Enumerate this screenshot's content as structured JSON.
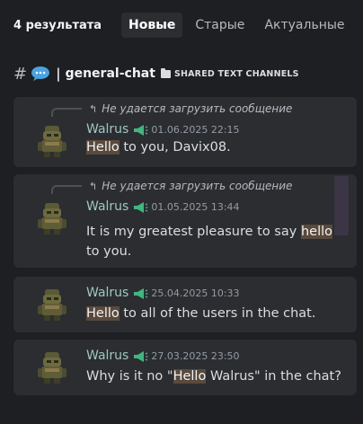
{
  "header": {
    "result_count": "4 результата",
    "tabs": [
      {
        "label": "Новые",
        "active": true
      },
      {
        "label": "Старые",
        "active": false
      },
      {
        "label": "Актуальные",
        "active": false
      }
    ]
  },
  "channel": {
    "hash": "#",
    "separator": "|",
    "name": "general-chat",
    "category": "SHARED TEXT CHANNELS",
    "icon": "speech-bubble-icon"
  },
  "results": [
    {
      "reply_preview": "Не удается загрузить сообщение",
      "author": "Walrus",
      "timestamp": "01.06.2025 22:15",
      "text_parts": [
        {
          "t": "Hello",
          "hl": true
        },
        {
          "t": " to you, Davix08.",
          "hl": false
        }
      ]
    },
    {
      "reply_preview": "Не удается загрузить сообщение",
      "author": "Walrus",
      "timestamp": "01.05.2025 13:44",
      "text_parts": [
        {
          "t": "It is my greatest pleasure to say ",
          "hl": false
        },
        {
          "t": "hello",
          "hl": true
        },
        {
          "t": " to you.",
          "hl": false
        }
      ]
    },
    {
      "reply_preview": null,
      "author": "Walrus",
      "timestamp": "25.04.2025 10:33",
      "text_parts": [
        {
          "t": "Hello",
          "hl": true
        },
        {
          "t": " to all of the users in the chat.",
          "hl": false
        }
      ]
    },
    {
      "reply_preview": null,
      "author": "Walrus",
      "timestamp": "27.03.2025 23:50",
      "text_parts": [
        {
          "t": "Why is it no \"",
          "hl": false
        },
        {
          "t": "Hello",
          "hl": true
        },
        {
          "t": " Walrus\" in the chat?",
          "hl": false
        }
      ]
    }
  ],
  "colors": {
    "background": "#1e1f22",
    "card": "#2b2d31",
    "author": "#9ec8c1",
    "highlight": "#5a4a3d",
    "badge": "#43b581"
  }
}
